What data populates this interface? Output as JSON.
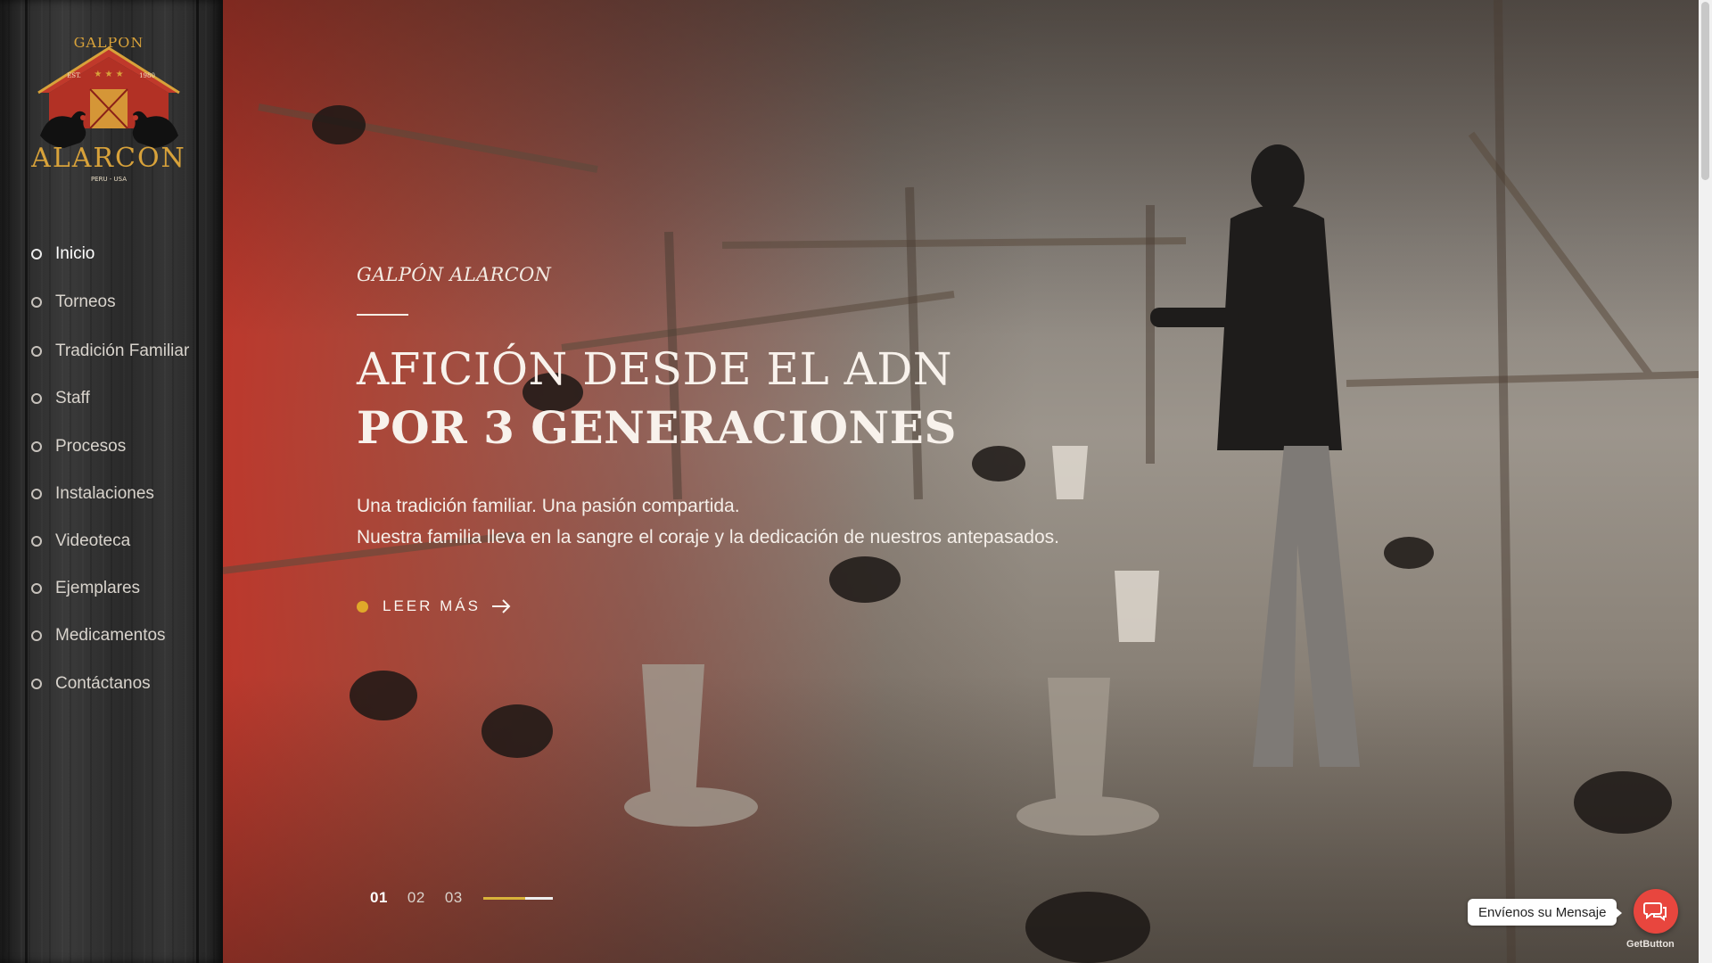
{
  "sidebar": {
    "logo": {
      "top_text": "GALPON",
      "est_left": "EST.",
      "est_right": "1980",
      "name": "ALARCON",
      "tagline": "PERU - USA"
    },
    "nav": [
      {
        "label": "Inicio",
        "active": true
      },
      {
        "label": "Torneos",
        "active": false
      },
      {
        "label": "Tradición Familiar",
        "active": false
      },
      {
        "label": "Staff",
        "active": false
      },
      {
        "label": "Procesos",
        "active": false
      },
      {
        "label": "Instalaciones",
        "active": false
      },
      {
        "label": "Videoteca",
        "active": false
      },
      {
        "label": "Ejemplares",
        "active": false
      },
      {
        "label": "Medicamentos",
        "active": false
      },
      {
        "label": "Contáctanos",
        "active": false
      }
    ]
  },
  "hero": {
    "eyebrow": "GALPÓN ALARCON",
    "headline_line1": "AFICIÓN DESDE EL ADN",
    "headline_line2": "POR 3 GENERACIONES",
    "sub_line1": "Una tradición familiar. Una pasión compartida.",
    "sub_line2": "Nuestra familia lleva en la sangre el coraje y la dedicación de nuestros antepasados.",
    "cta_label": "LEER MÁS",
    "slides": [
      "01",
      "02",
      "03"
    ],
    "active_slide": "01",
    "slide_progress": 0.6
  },
  "chat": {
    "bubble_text": "Envíenos su Mensaje",
    "branding": "GetButton"
  },
  "colors": {
    "accent_gold": "#e0a92a",
    "hero_overlay_red": "#be3428",
    "chat_red": "#e8463e",
    "logo_gold": "#d8a23a"
  },
  "icons": {
    "cta": "arrow-right-icon",
    "chat": "chat-bubbles-icon",
    "nav_bullet": "ring-bullet-icon"
  }
}
